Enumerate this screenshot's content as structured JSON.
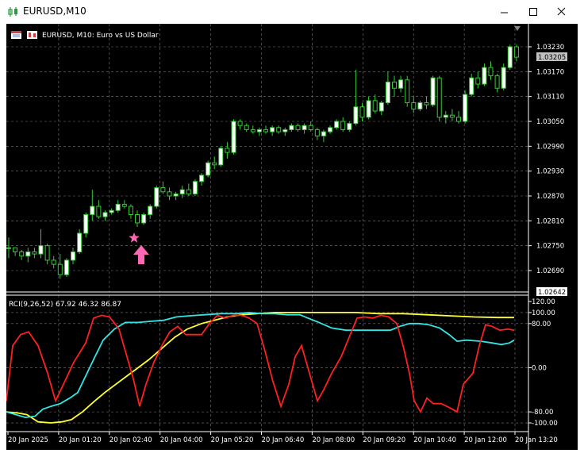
{
  "window": {
    "title": "EURUSD,M10",
    "buttons": [
      "minimize",
      "maximize",
      "close"
    ]
  },
  "chart_header": "EURUSD, M10:  Euro vs US Dollar",
  "indicator_header": "RCI(9,26,52) 67.92 46.32 86.87",
  "colors": {
    "background": "#000000",
    "grid": "#7a7a7a",
    "bull_candle": "#ffffff",
    "bear_candle": "#000000",
    "wick": "#33cc33",
    "rci_short": "#ff2020",
    "rci_mid": "#33e6e6",
    "rci_long": "#ffff33",
    "marker": "#ff69b4"
  },
  "price_axis": {
    "ticks": [
      "1.03230",
      "1.03170",
      "1.03110",
      "1.03050",
      "1.02990",
      "1.02930",
      "1.02870",
      "1.02810",
      "1.02750",
      "1.02690"
    ],
    "current_price": "1.03205",
    "bottom_price": "1.02642"
  },
  "indicator_axis": {
    "ticks": [
      "120.00",
      "100.00",
      "80.00",
      "0.00",
      "-80.00",
      "-100.00"
    ]
  },
  "time_axis": {
    "labels": [
      "20 Jan 2025",
      "20 Jan 01:20",
      "20 Jan 02:40",
      "20 Jan 04:00",
      "20 Jan 05:20",
      "20 Jan 06:40",
      "20 Jan 08:00",
      "20 Jan 09:20",
      "20 Jan 10:40",
      "20 Jan 12:00",
      "20 Jan 13:20"
    ]
  },
  "markers": {
    "star": "star-icon",
    "arrow": "up-arrow-icon"
  }
}
